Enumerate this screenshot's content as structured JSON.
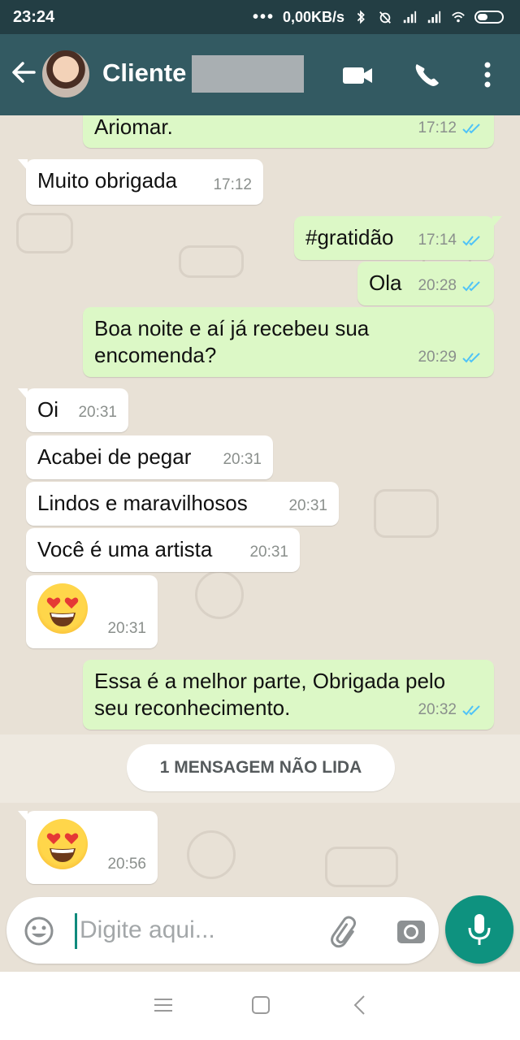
{
  "status_bar": {
    "time": "23:24",
    "network_speed": "0,00KB/s",
    "icons": [
      "more-dots-icon",
      "bluetooth-icon",
      "alarm-off-icon",
      "signal-icon",
      "signal-icon",
      "wifi-icon",
      "battery-icon"
    ]
  },
  "header": {
    "contact_name": "Cliente",
    "avatar": "avatar",
    "actions": [
      "video-call-icon",
      "voice-call-icon",
      "more-options-icon"
    ]
  },
  "messages": [
    {
      "dir": "out",
      "text": "Ariomar.",
      "time": "17:12",
      "status": "read"
    },
    {
      "dir": "in",
      "text": "Muito obrigada",
      "time": "17:12"
    },
    {
      "dir": "out",
      "text": "#gratidão",
      "time": "17:14",
      "status": "read"
    },
    {
      "dir": "out",
      "text": "Ola",
      "time": "20:28",
      "status": "read"
    },
    {
      "dir": "out",
      "text": "Boa noite e aí já recebeu sua encomenda?",
      "time": "20:29",
      "status": "read"
    },
    {
      "dir": "in",
      "text": "Oi",
      "time": "20:31"
    },
    {
      "dir": "in",
      "text": "Acabei de pegar",
      "time": "20:31"
    },
    {
      "dir": "in",
      "text": "Lindos e maravilhosos",
      "time": "20:31"
    },
    {
      "dir": "in",
      "text": "Você é uma artista",
      "time": "20:31"
    },
    {
      "dir": "in",
      "text": "",
      "emoji": "heart-eyes-emoji",
      "time": "20:31"
    },
    {
      "dir": "out",
      "text": "Essa é a melhor parte, Obrigada pelo seu reconhecimento.",
      "time": "20:32",
      "status": "read"
    },
    {
      "dir": "in",
      "text": "",
      "emoji": "heart-eyes-emoji",
      "time": "20:56"
    }
  ],
  "unread_divider": "1 MENSAGEM NÃO LIDA",
  "composer": {
    "placeholder": "Digite aqui...",
    "buttons": [
      "emoji-icon",
      "attach-icon",
      "camera-icon",
      "mic-icon"
    ]
  },
  "nav": [
    "menu-icon",
    "home-icon",
    "back-icon"
  ],
  "colors": {
    "status_bar": "#233e44",
    "header": "#335a62",
    "outgoing_bubble": "#dcf8c6",
    "incoming_bubble": "#ffffff",
    "read_ticks": "#4fc3f7",
    "mic_button": "#0e927f"
  }
}
